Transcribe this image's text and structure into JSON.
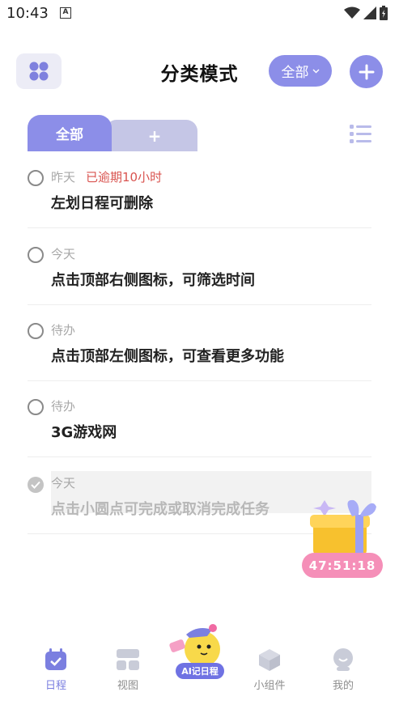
{
  "status_bar": {
    "time": "10:43",
    "notif_icon": "A"
  },
  "header": {
    "title": "分类模式",
    "filter_label": "全部"
  },
  "tabs": [
    {
      "label": "全部"
    },
    {
      "label": "+"
    }
  ],
  "tasks": [
    {
      "date": "昨天",
      "overdue": "已逾期10小时",
      "title": "左划日程可删除",
      "done": false
    },
    {
      "date": "今天",
      "overdue": "",
      "title": "点击顶部右侧图标，可筛选时间",
      "done": false
    },
    {
      "date": "待办",
      "overdue": "",
      "title": "点击顶部左侧图标，可查看更多功能",
      "done": false
    },
    {
      "date": "待办",
      "overdue": "",
      "title": "3G游戏网",
      "done": false
    },
    {
      "date": "今天",
      "overdue": "",
      "title": "点击小圆点可完成或取消完成任务",
      "done": true
    }
  ],
  "gift": {
    "countdown": "47:51:18"
  },
  "tabbar": {
    "items": [
      {
        "label": "日程",
        "icon": "calendar-icon",
        "active": true
      },
      {
        "label": "视图",
        "icon": "view-grid-icon",
        "active": false
      },
      {
        "label": "小组件",
        "icon": "cube-icon",
        "active": false
      },
      {
        "label": "我的",
        "icon": "profile-icon",
        "active": false
      }
    ],
    "ai_label": "AI记日程"
  },
  "colors": {
    "accent": "#8c8ee8",
    "tab_inactive": "#c5c6e6",
    "overdue": "#d9534f",
    "timer": "#f58fb8"
  }
}
